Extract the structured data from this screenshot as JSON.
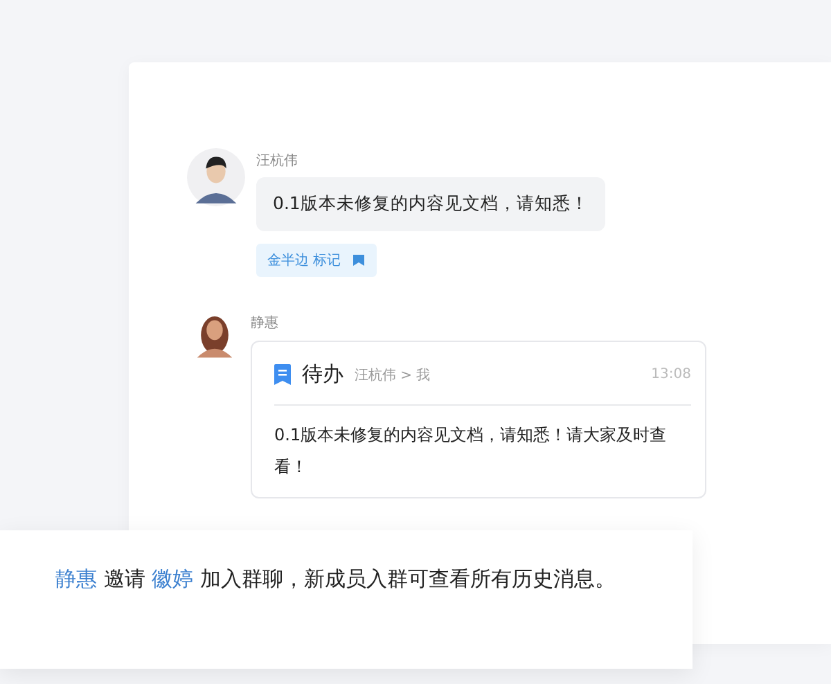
{
  "messages": [
    {
      "kind": "text",
      "sender": "汪杭伟",
      "avatar": {
        "kind": "man"
      },
      "text": "0.1版本未修复的内容见文档，请知悉！",
      "tag": {
        "label": "金半边 标记"
      }
    },
    {
      "kind": "todo",
      "sender": "静惠",
      "avatar": {
        "kind": "woman"
      },
      "card": {
        "title": "待办",
        "route": "汪杭伟 > 我",
        "time": "13:08",
        "body": "0.1版本未修复的内容见文档，请知悉！请大家及时查看！"
      }
    }
  ],
  "notice": {
    "parts": [
      {
        "kind": "mention",
        "text": "静惠"
      },
      {
        "kind": "text",
        "text": " 邀请 "
      },
      {
        "kind": "mention",
        "text": "徽婷"
      },
      {
        "kind": "text",
        "text": " 加入群聊，新成员入群可查看所有历史消息。"
      }
    ]
  }
}
